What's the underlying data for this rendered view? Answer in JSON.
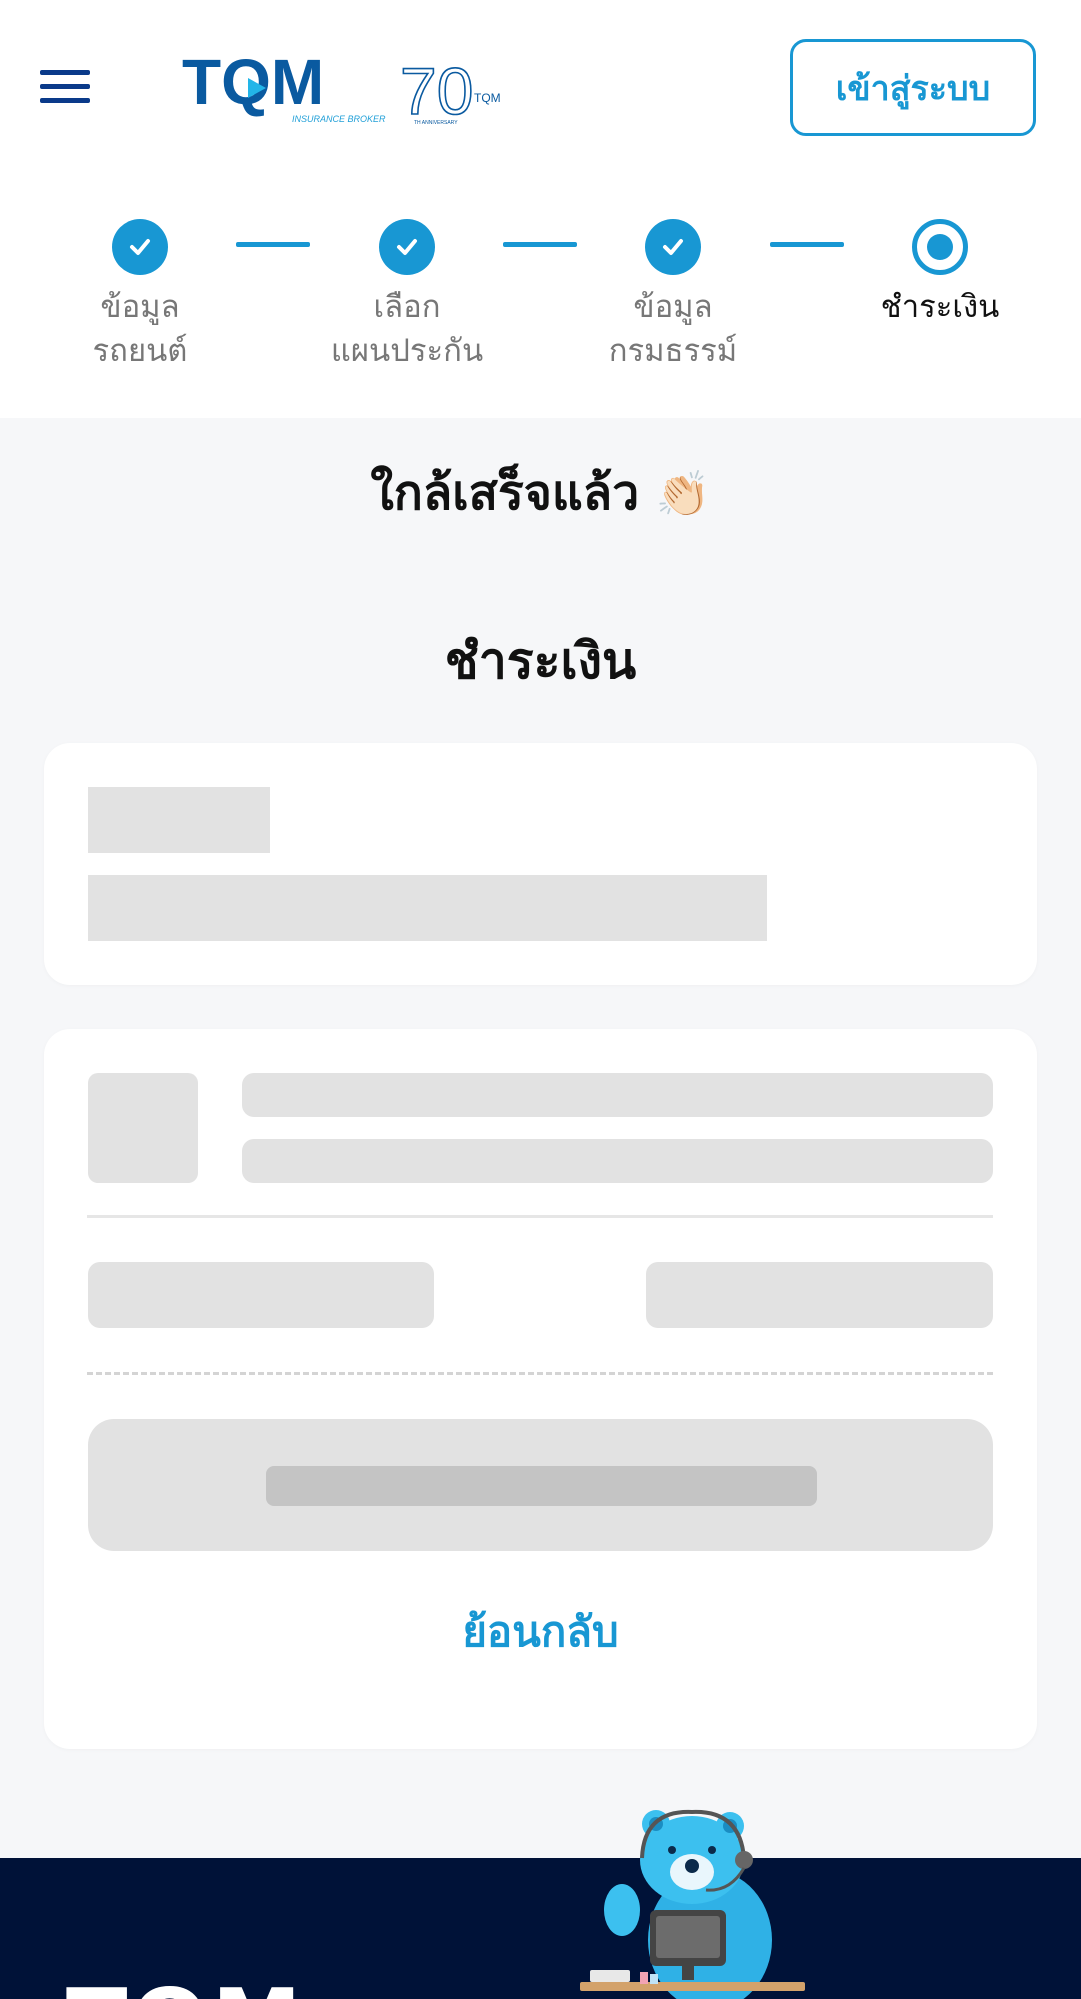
{
  "header": {
    "logo_text": "TQM",
    "logo_sub": "INSURANCE BROKER",
    "anniversary_logo_text": "70",
    "anniversary_logo_brand": "TQM",
    "anniversary_logo_sub": "TH ANNIVERSARY",
    "login_label": "เข้าสู่ระบบ"
  },
  "stepper": {
    "steps": [
      {
        "label": "ข้อมูล\nรถยนต์",
        "status": "done"
      },
      {
        "label": "เลือก\nแผนประกัน",
        "status": "done"
      },
      {
        "label": "ข้อมูล\nกรมธรรม์",
        "status": "done"
      },
      {
        "label": "ชำระเงิน",
        "status": "current"
      }
    ],
    "accent_color": "#1897d3"
  },
  "main": {
    "almost_done_text": "ใกล้เสร็จแล้ว",
    "almost_done_emoji": "👏🏻",
    "section_title": "ชำระเงิน",
    "back_label": "ย้อนกลับ"
  },
  "footer": {
    "text": "TQM"
  }
}
